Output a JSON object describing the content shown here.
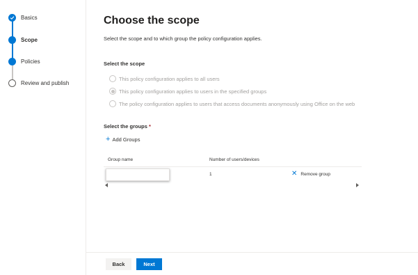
{
  "steps": [
    {
      "label": "Basics",
      "state": "done"
    },
    {
      "label": "Scope",
      "state": "current"
    },
    {
      "label": "Policies",
      "state": "upcoming"
    },
    {
      "label": "Review and publish",
      "state": "upcoming"
    }
  ],
  "page": {
    "title": "Choose the scope",
    "subtitle": "Select the scope and to which group the policy configuration applies."
  },
  "scope": {
    "heading": "Select the scope",
    "options": [
      {
        "label": "This policy configuration applies to all users",
        "selected": false
      },
      {
        "label": "This policy configuration applies to users in the specified groups",
        "selected": true
      },
      {
        "label": "The policy configuration applies to users that access documents anonymously using Office on the web",
        "selected": false
      }
    ]
  },
  "groups": {
    "heading": "Select the groups",
    "required_mark": "*",
    "add_label": "Add Groups",
    "columns": [
      "Group name",
      "Number of users/devices"
    ],
    "rows": [
      {
        "group_name": "",
        "count": "1",
        "remove_label": "Remove group"
      }
    ]
  },
  "footer": {
    "back_label": "Back",
    "next_label": "Next"
  },
  "colors": {
    "accent": "#0078d4",
    "disabled_text": "#a19f9d",
    "required": "#a4262c"
  }
}
